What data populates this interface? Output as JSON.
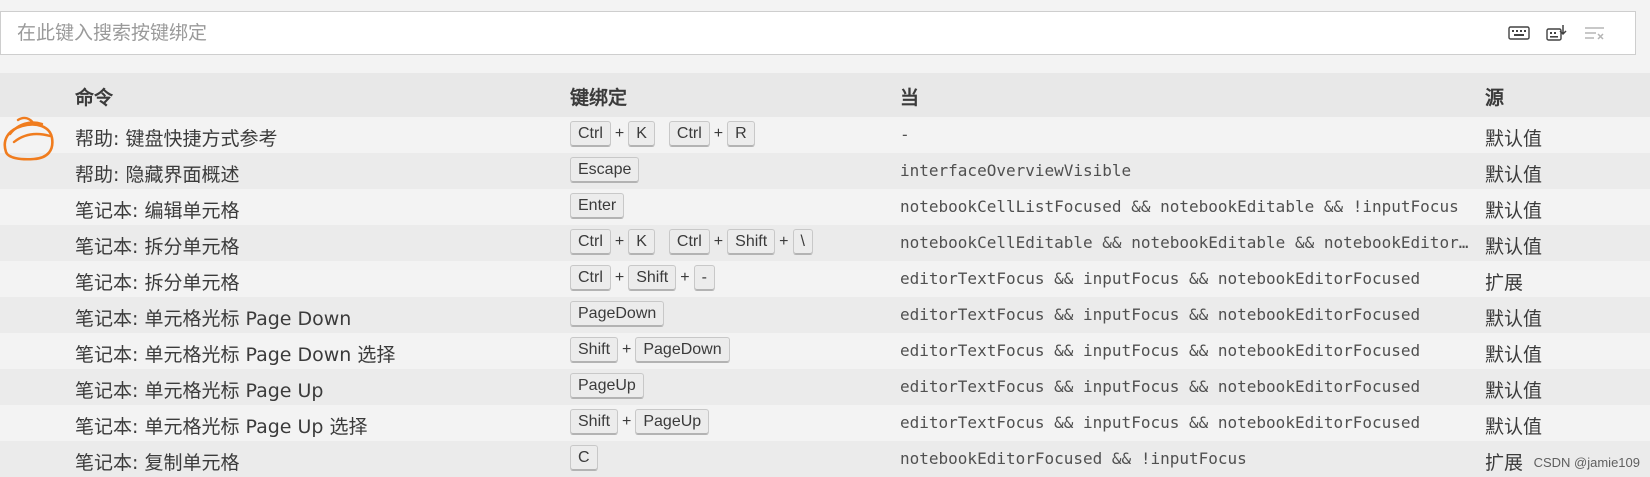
{
  "search": {
    "placeholder": "在此键入搜索按键绑定",
    "value": "",
    "actions": [
      {
        "icon": "keyboard-icon",
        "name": "record-keys-button"
      },
      {
        "icon": "sort-by-precedence-icon",
        "name": "sort-precedence-button"
      },
      {
        "icon": "clear-filter-icon",
        "name": "clear-search-button"
      }
    ]
  },
  "table": {
    "headers": {
      "command": "命令",
      "keybinding": "键绑定",
      "when": "当",
      "source": "源"
    },
    "rows": [
      {
        "command": "帮助: 键盘快捷方式参考",
        "chords": [
          [
            "Ctrl",
            "K"
          ],
          [
            "Ctrl",
            "R"
          ]
        ],
        "when": "-",
        "source": "默认值"
      },
      {
        "command": "帮助: 隐藏界面概述",
        "chords": [
          [
            "Escape"
          ]
        ],
        "when": "interfaceOverviewVisible",
        "source": "默认值"
      },
      {
        "command": "笔记本: 编辑单元格",
        "chords": [
          [
            "Enter"
          ]
        ],
        "when": "notebookCellListFocused && notebookEditable && !inputFocus",
        "source": "默认值"
      },
      {
        "command": "笔记本: 拆分单元格",
        "chords": [
          [
            "Ctrl",
            "K"
          ],
          [
            "Ctrl",
            "Shift",
            "\\"
          ]
        ],
        "when": "notebookCellEditable && notebookEditable && notebookEditorFocused",
        "source": "默认值"
      },
      {
        "command": "笔记本: 拆分单元格",
        "chords": [
          [
            "Ctrl",
            "Shift",
            "-"
          ]
        ],
        "when": "editorTextFocus && inputFocus && notebookEditorFocused",
        "source": "扩展"
      },
      {
        "command": "笔记本: 单元格光标 Page Down",
        "chords": [
          [
            "PageDown"
          ]
        ],
        "when": "editorTextFocus && inputFocus && notebookEditorFocused",
        "source": "默认值"
      },
      {
        "command": "笔记本: 单元格光标 Page Down 选择",
        "chords": [
          [
            "Shift",
            "PageDown"
          ]
        ],
        "when": "editorTextFocus && inputFocus && notebookEditorFocused",
        "source": "默认值"
      },
      {
        "command": "笔记本: 单元格光标 Page Up",
        "chords": [
          [
            "PageUp"
          ]
        ],
        "when": "editorTextFocus && inputFocus && notebookEditorFocused",
        "source": "默认值"
      },
      {
        "command": "笔记本: 单元格光标 Page Up 选择",
        "chords": [
          [
            "Shift",
            "PageUp"
          ]
        ],
        "when": "editorTextFocus && inputFocus && notebookEditorFocused",
        "source": "默认值"
      },
      {
        "command": "笔记本: 复制单元格",
        "chords": [
          [
            "C"
          ]
        ],
        "when": "notebookEditorFocused && !inputFocus",
        "source": "扩展"
      }
    ]
  },
  "watermark": "CSDN @jamie109",
  "colors": {
    "background": "#f3f3f3",
    "row_alt": "#ebebeb",
    "header_bg": "#e8e8e8",
    "annotation": "#f07c1e"
  }
}
